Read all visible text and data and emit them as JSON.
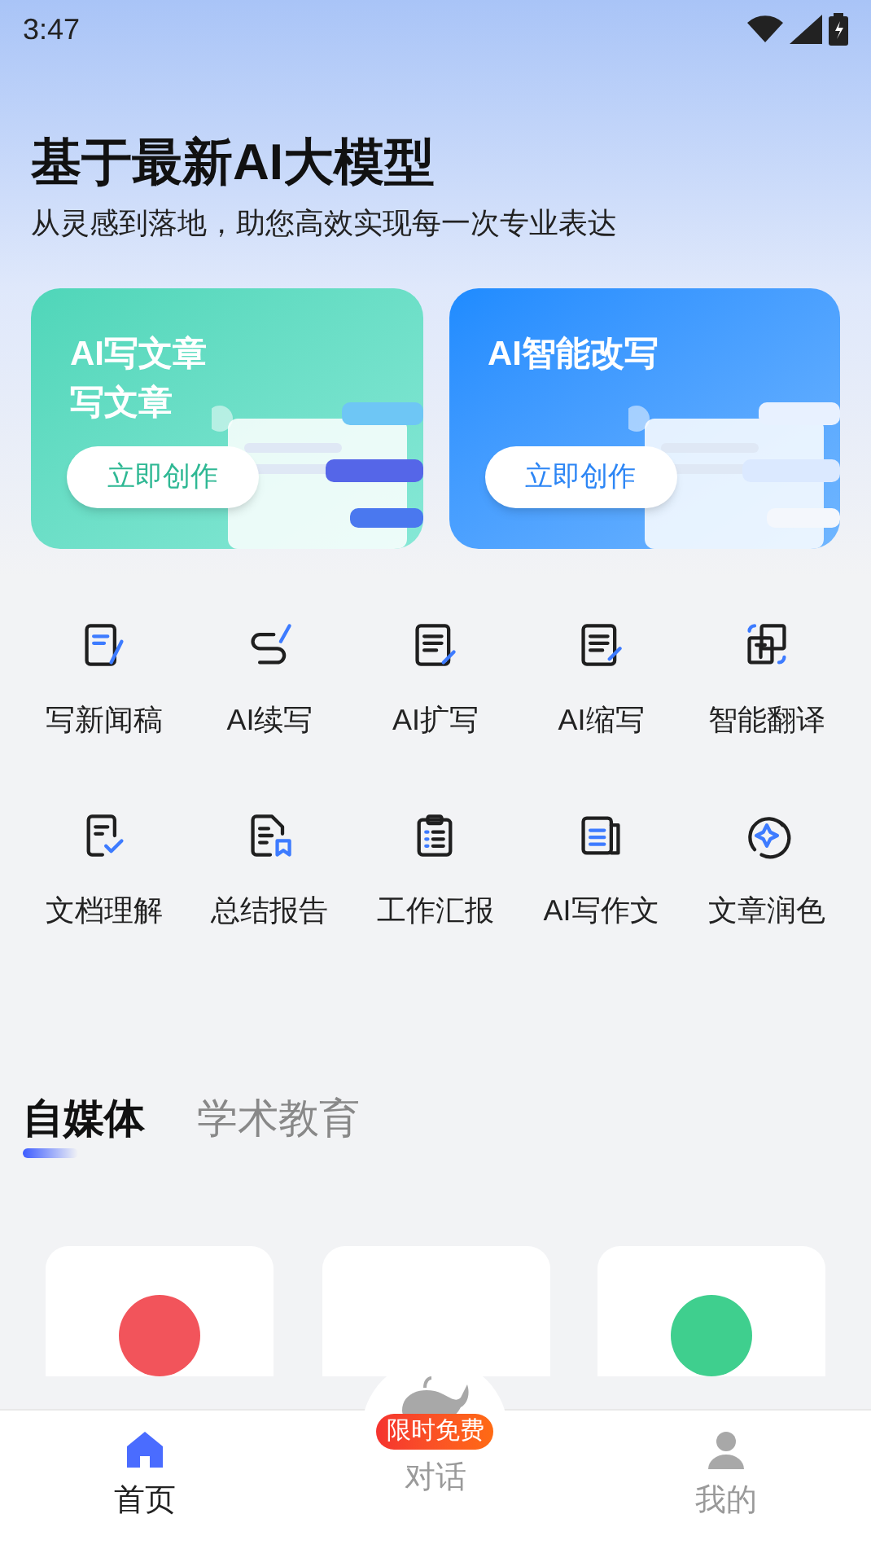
{
  "status_bar": {
    "time": "3:47"
  },
  "header": {
    "title": "基于最新AI大模型",
    "subtitle": "从灵感到落地，助您高效实现每一次专业表达"
  },
  "banners": [
    {
      "kind": "green",
      "title_lines": [
        "AI写文章",
        "写文章"
      ],
      "button": "立即创作"
    },
    {
      "kind": "blue",
      "title_lines": [
        "AI智能改写"
      ],
      "button": "立即创作"
    }
  ],
  "tools": [
    {
      "label": "写新闻稿"
    },
    {
      "label": "AI续写"
    },
    {
      "label": "AI扩写"
    },
    {
      "label": "AI缩写"
    },
    {
      "label": "智能翻译"
    },
    {
      "label": "文档理解"
    },
    {
      "label": "总结报告"
    },
    {
      "label": "工作汇报"
    },
    {
      "label": "AI写作文"
    },
    {
      "label": "文章润色"
    }
  ],
  "category_tabs": [
    {
      "label": "自媒体",
      "selected": true
    },
    {
      "label": "学术教育",
      "selected": false
    }
  ],
  "template_cards": [
    {
      "kind": "dot",
      "color": "#f2545b"
    },
    {
      "kind": "empty"
    },
    {
      "kind": "dot",
      "color": "#3fcf8e"
    }
  ],
  "bottom_nav": [
    {
      "kind": "home",
      "label": "首页",
      "selected": true
    },
    {
      "kind": "chat",
      "label": "对话",
      "badge": "限时免费",
      "selected": false
    },
    {
      "kind": "profile",
      "label": "我的",
      "selected": false
    }
  ]
}
